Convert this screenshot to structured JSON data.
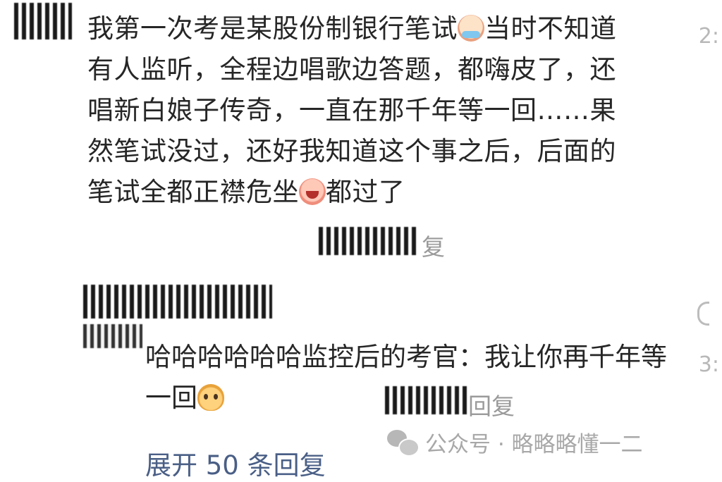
{
  "comment": {
    "segments": [
      {
        "type": "text",
        "value": "我第一次考是某股份制银行笔试"
      },
      {
        "type": "emoji",
        "name": "crying-emoji"
      },
      {
        "type": "text",
        "value": "当时不知道有人监听，全程边唱歌边答题，都嗨皮了，还唱新白娘子传奇，一直在那千年等一回……果然笔试没过，还好我知道这个事之后，后面的笔试全都正襟危坐"
      },
      {
        "type": "emoji",
        "name": "laughing-crying-emoji"
      },
      {
        "type": "text",
        "value": "都过了"
      }
    ],
    "reply_label": "复",
    "timestamp": "2:"
  },
  "sub_reply": {
    "text_before": "哈哈哈哈哈哈监控后的考官：我让你再千年等一回",
    "emoji": "pudding-emoji",
    "reply_label": "回复",
    "timestamp": "3:"
  },
  "expand_label": "展开 50 条回复",
  "watermark": {
    "text": "公众号 · 略略略懂一二",
    "icon": "wechat-icon"
  }
}
